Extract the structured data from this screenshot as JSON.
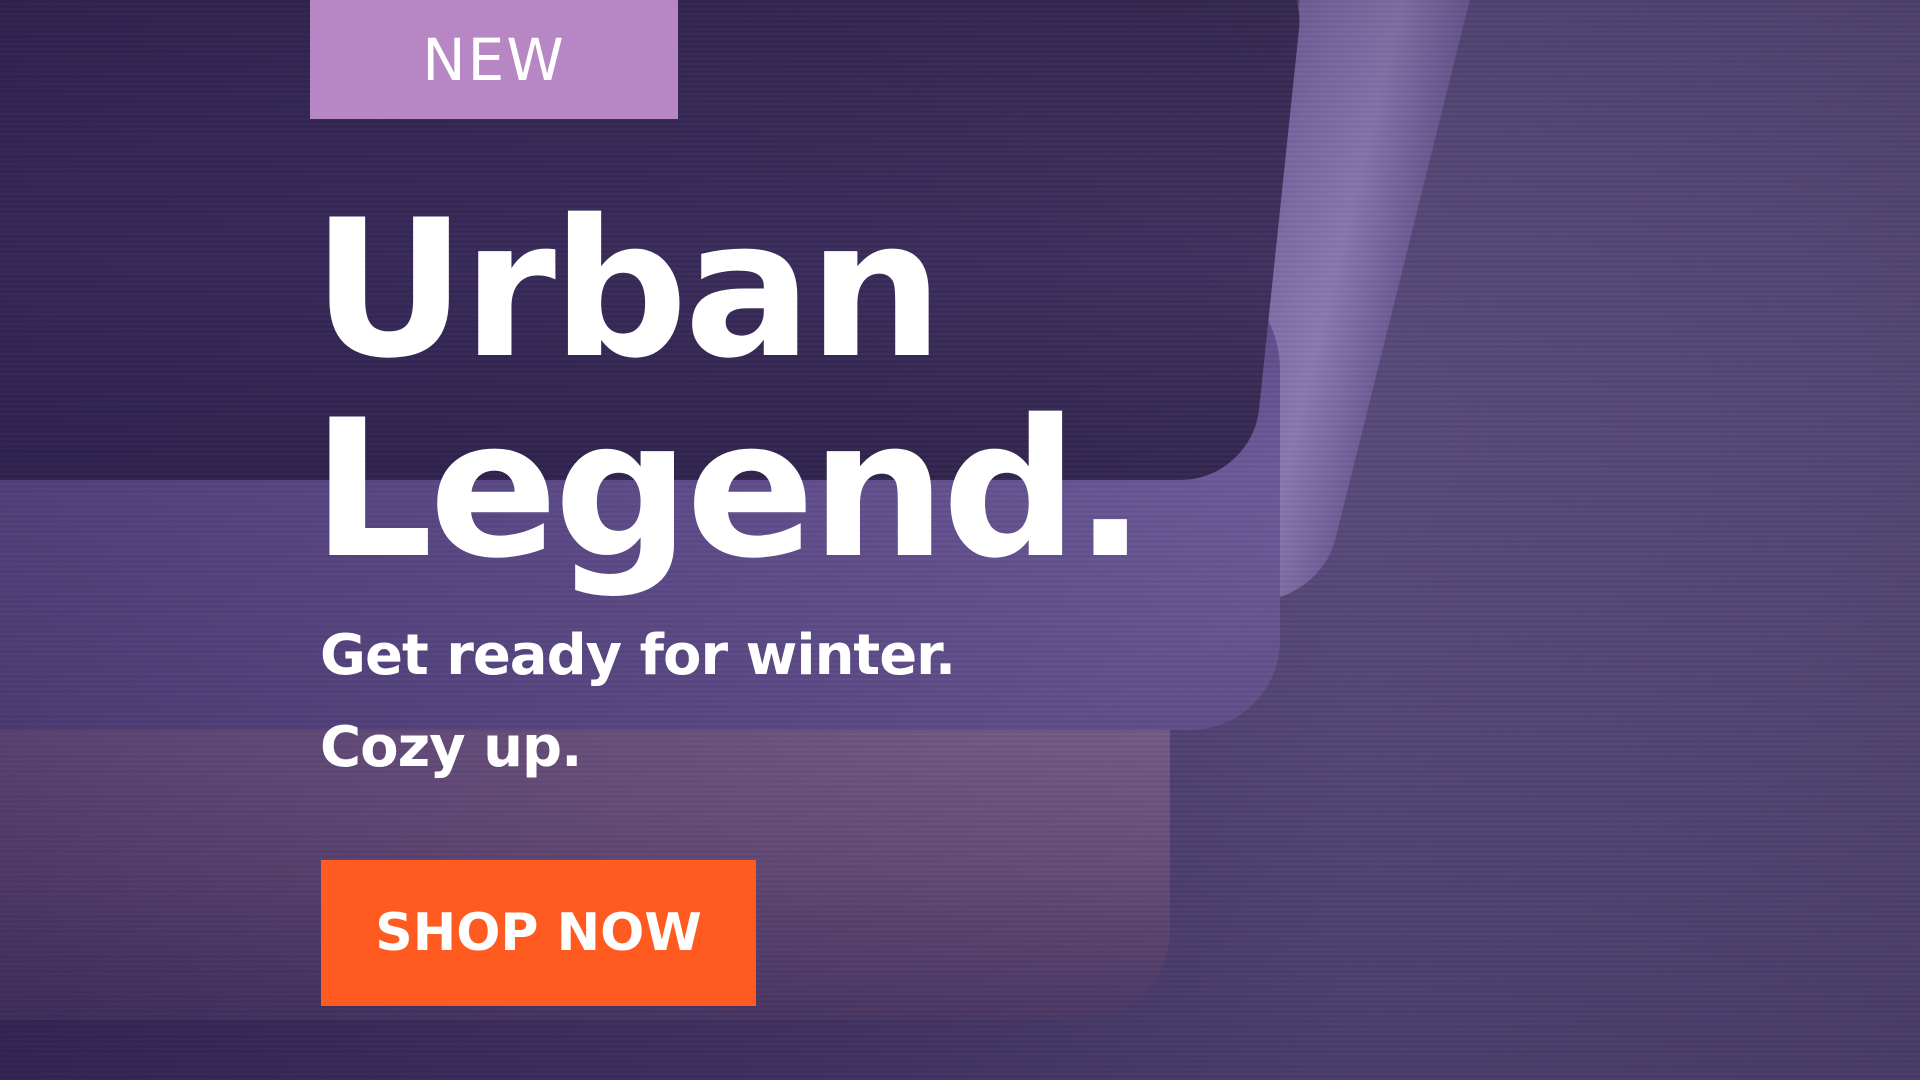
{
  "banner": {
    "badge": "NEW",
    "headline_line1": "Urban",
    "headline_line2": "Legend.",
    "subline_line1": "Get ready for winter.",
    "subline_line2": "Cozy up.",
    "cta_label": "SHOP NOW"
  },
  "colors": {
    "badge_bg": "#b786c4",
    "cta_bg": "#ff5a1f",
    "text": "#ffffff",
    "overlay": "#4a3b6d"
  }
}
